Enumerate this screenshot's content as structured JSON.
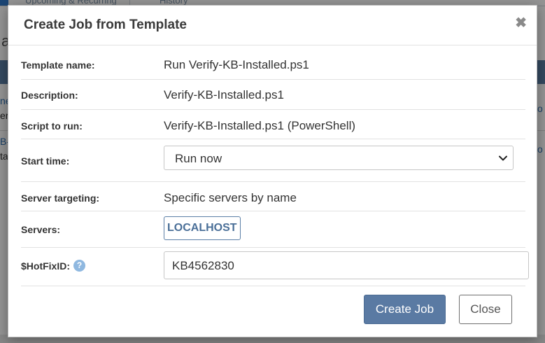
{
  "background_page": {
    "tabs": [
      "Upcoming & Recurring",
      "History"
    ],
    "heading_fragment": "a",
    "row_fragments": [
      {
        "left": "ne",
        "right": "o"
      },
      {
        "left": "er",
        "right": ""
      },
      {
        "left": "B-",
        "right": "o"
      },
      {
        "left": "ta",
        "right": ""
      }
    ]
  },
  "modal": {
    "title": "Create Job from Template",
    "close_icon": "close-icon",
    "fields": {
      "template_name": {
        "label": "Template name:",
        "value": "Run Verify-KB-Installed.ps1"
      },
      "description": {
        "label": "Description:",
        "value": "Verify-KB-Installed.ps1"
      },
      "script_to_run": {
        "label": "Script to run:",
        "value": "Verify-KB-Installed.ps1 (PowerShell)"
      },
      "start_time": {
        "label": "Start time:",
        "value": "Run now",
        "icon": "chevron-down-icon"
      },
      "server_targeting": {
        "label": "Server targeting:",
        "value": "Specific servers by name"
      },
      "servers": {
        "label": "Servers:",
        "tags": [
          "LOCALHOST"
        ]
      },
      "hotfix_id": {
        "label": "$HotFixID:",
        "value": "KB4562830",
        "help_icon": "?"
      }
    },
    "buttons": {
      "create": "Create Job",
      "close": "Close"
    }
  },
  "colors": {
    "primary_button": "#5a7aa3",
    "help_icon": "#8fb8e0",
    "tag_text": "#4a6f98"
  }
}
